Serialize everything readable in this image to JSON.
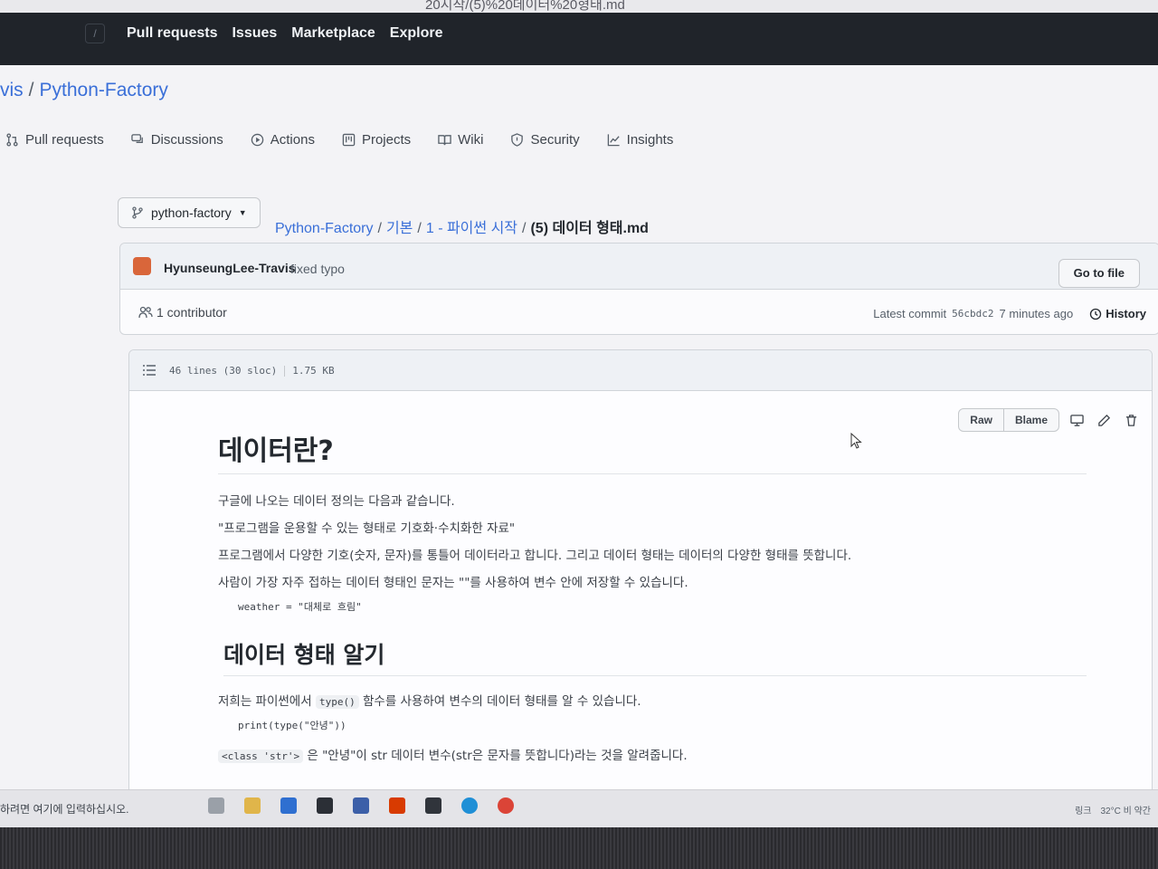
{
  "window": {
    "title_fragment": "20시작/(5)%20데이터%20형태.md"
  },
  "global_nav": {
    "items": [
      "Pull requests",
      "Issues",
      "Marketplace",
      "Explore"
    ]
  },
  "repo": {
    "owner_fragment": "vis",
    "name": "Python-Factory"
  },
  "repo_tabs": [
    {
      "label": "Pull requests",
      "icon": "pull-request-icon"
    },
    {
      "label": "Discussions",
      "icon": "discussions-icon"
    },
    {
      "label": "Actions",
      "icon": "actions-icon"
    },
    {
      "label": "Projects",
      "icon": "projects-icon"
    },
    {
      "label": "Wiki",
      "icon": "wiki-icon"
    },
    {
      "label": "Security",
      "icon": "shield-icon"
    },
    {
      "label": "Insights",
      "icon": "graph-icon"
    }
  ],
  "branch": {
    "name": "python-factory"
  },
  "breadcrumb": {
    "root": "Python-Factory",
    "level1": "기본",
    "level2": "1 - 파이썬 시작",
    "file": "(5) 데이터 형태.md"
  },
  "go_to_file": "Go to file",
  "commit": {
    "author": "HyunseungLee-Travis",
    "message": "fixed typo",
    "contributors": "1 contributor",
    "latest_label": "Latest commit",
    "hash": "56cbdc2",
    "time": "7 minutes ago",
    "history_label": "History"
  },
  "file": {
    "lines": "46 lines (30 sloc)",
    "size": "1.75 KB",
    "raw_label": "Raw",
    "blame_label": "Blame"
  },
  "content": {
    "h1": "데이터란?",
    "p1": "구글에 나오는 데이터 정의는 다음과 같습니다.",
    "p2": "\"프로그램을 운용할 수 있는 형태로 기호화·수치화한 자료\"",
    "p3": "프로그램에서 다양한 기호(숫자, 문자)를 통틀어 데이터라고 합니다. 그리고 데이터 형태는 데이터의 다양한 형태를 뜻합니다.",
    "p4": "사람이 가장 자주 접하는 데이터 형태인 문자는 \"\"를 사용하여 변수 안에 저장할 수 있습니다.",
    "code1": "weather = \"대체로 흐림\"",
    "h2": "데이터 형태 알기",
    "p5_before": "저희는 파이썬에서",
    "p5_code": "type()",
    "p5_after": "함수를 사용하여 변수의 데이터 형태를 알 수 있습니다.",
    "code2": "print(type(\"안녕\"))",
    "p6_code": "<class 'str'>",
    "p6_after": "은 \"안녕\"이 str 데이터 변수(str은 문자를 뜻합니다)라는 것을 알려줍니다."
  },
  "taskbar": {
    "search_hint": "하려면 여기에 입력하십시오.",
    "tray_weather": "32°C 비 약간",
    "tray_left": "링크"
  },
  "colors": {
    "link": "#3a6fd8",
    "header_bg": "#20242a",
    "avatar": "#d9663a"
  }
}
